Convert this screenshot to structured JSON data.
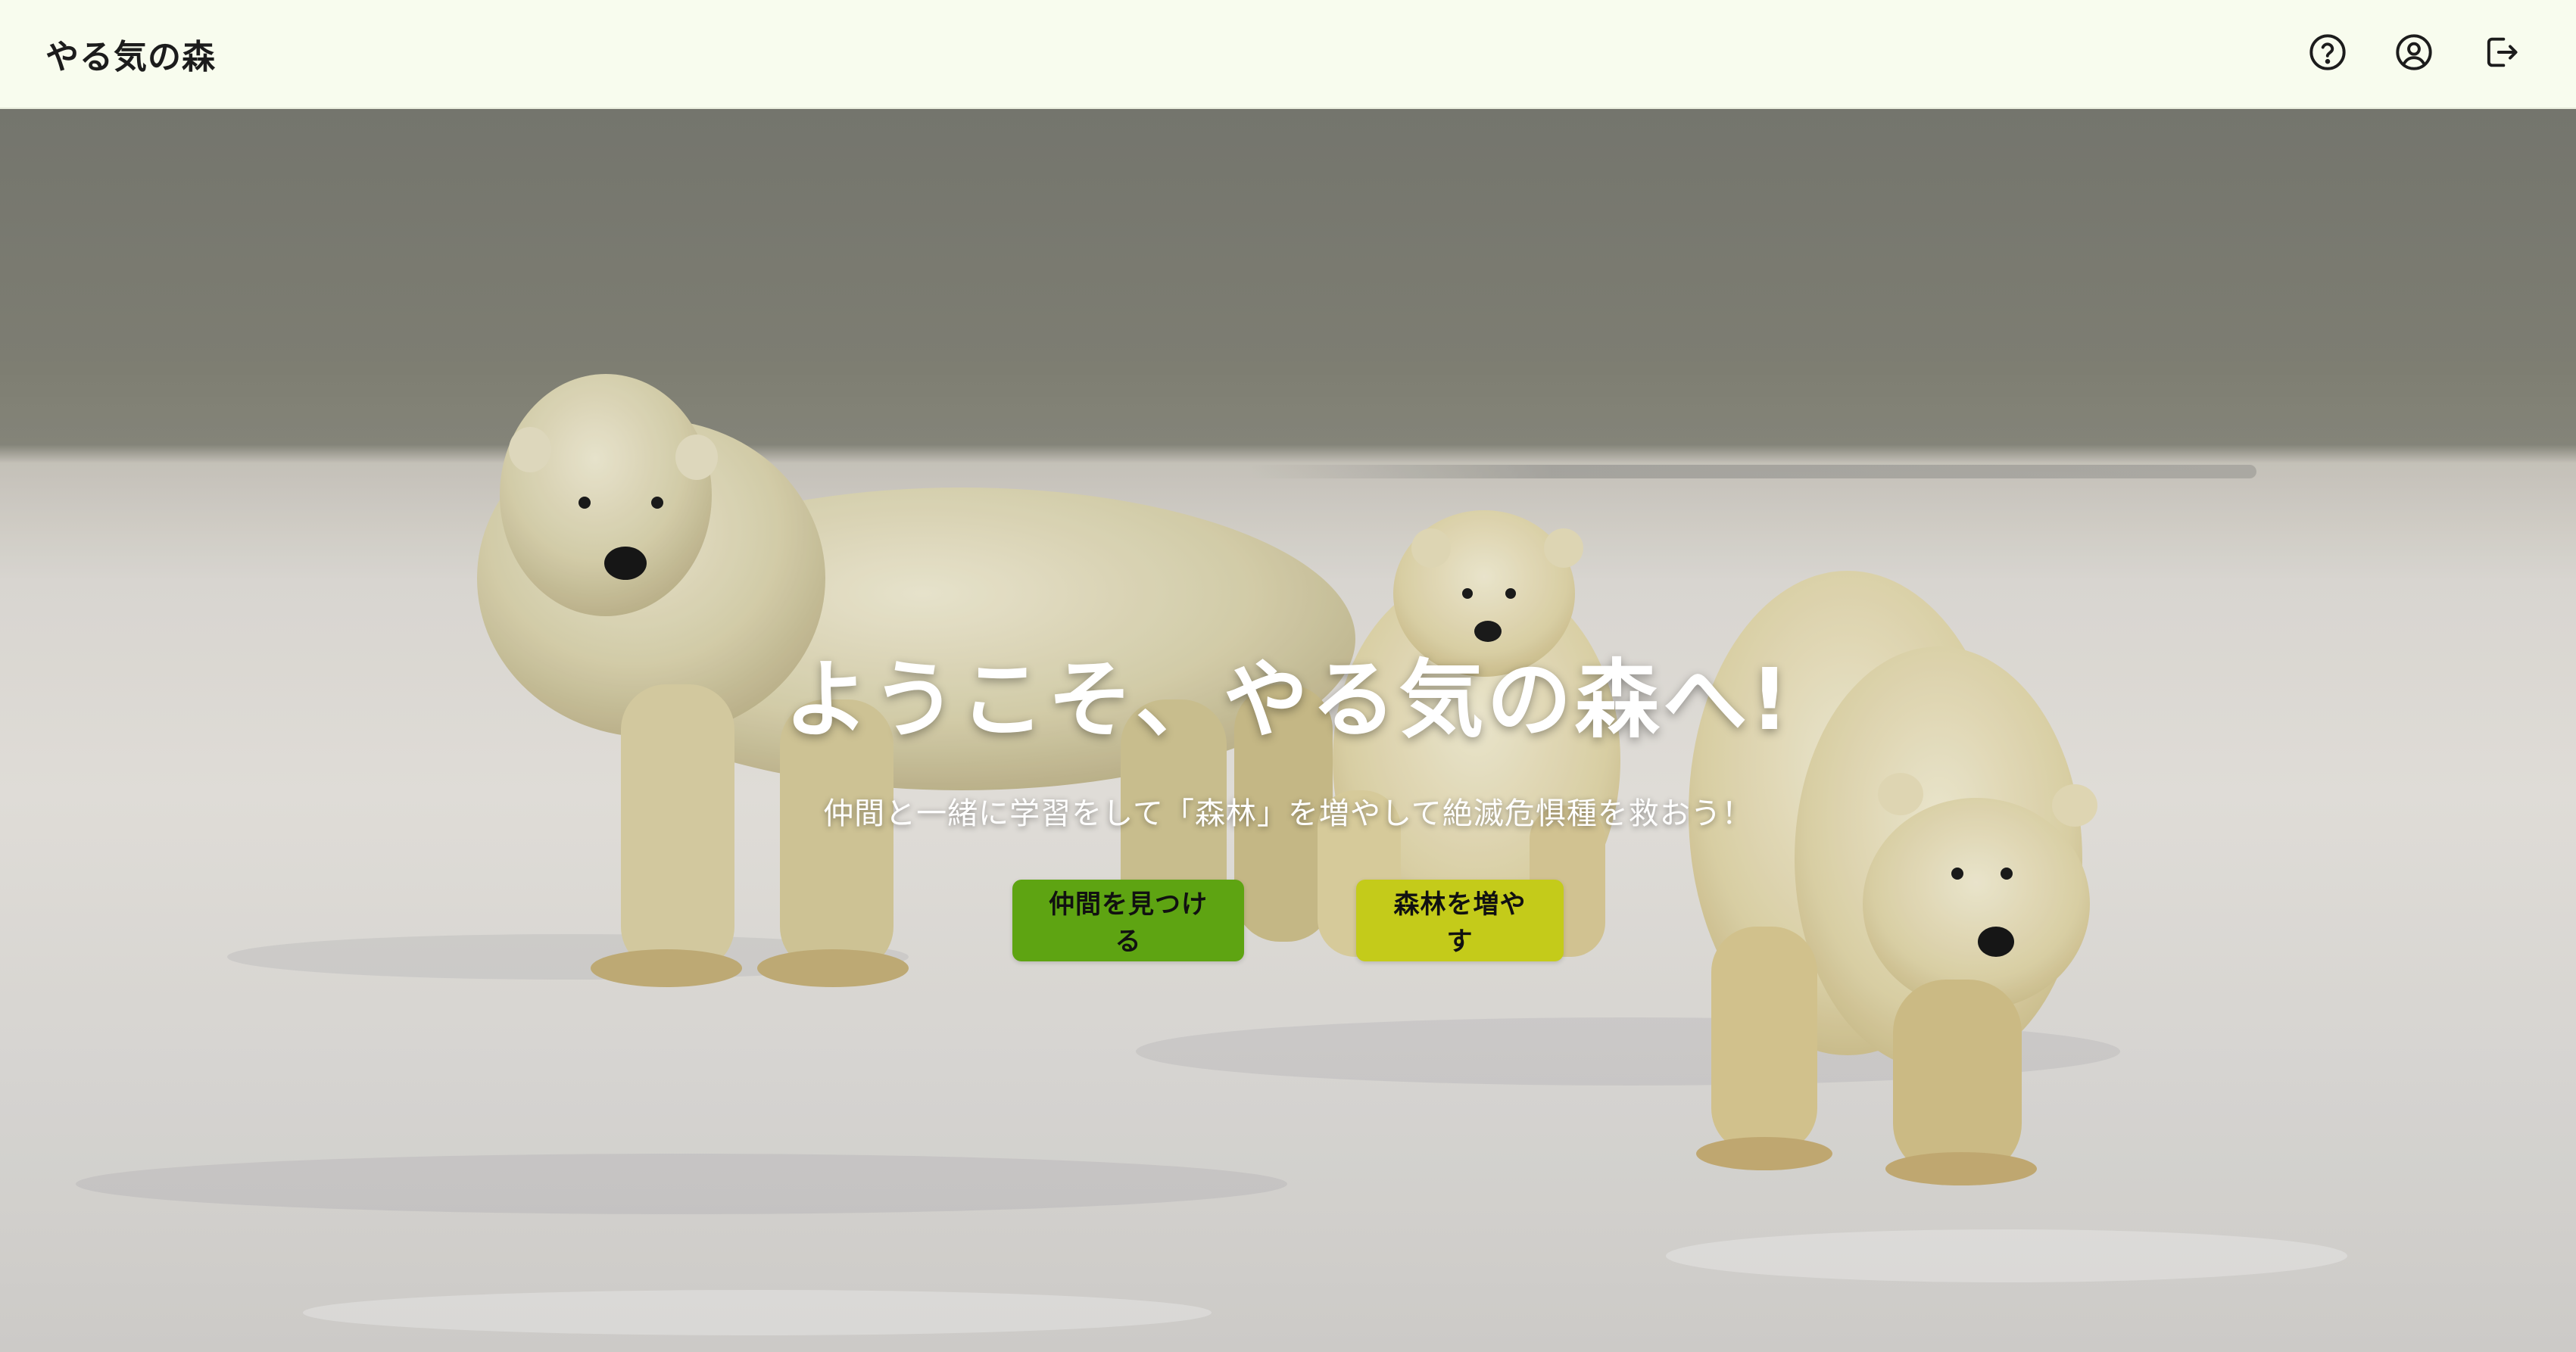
{
  "header": {
    "brand": "やる気の森",
    "actions": [
      {
        "name": "help",
        "icon": "help-circle-icon"
      },
      {
        "name": "profile",
        "icon": "user-circle-icon"
      },
      {
        "name": "logout",
        "icon": "logout-icon"
      }
    ]
  },
  "hero": {
    "title": "ようこそ、やる気の森へ!",
    "subtitle": "仲間と一緒に学習をして「森林」を増やして絶滅危惧種を救おう！",
    "primary_button": "仲間を見つける",
    "secondary_button": "森林を増やす",
    "background": "polar-bears-on-snow-photo"
  },
  "colors": {
    "header_bg": "#f8fcee",
    "primary_button": "#5ea412",
    "secondary_button": "#c4cb1a",
    "text_dark": "#1c1c1c"
  }
}
